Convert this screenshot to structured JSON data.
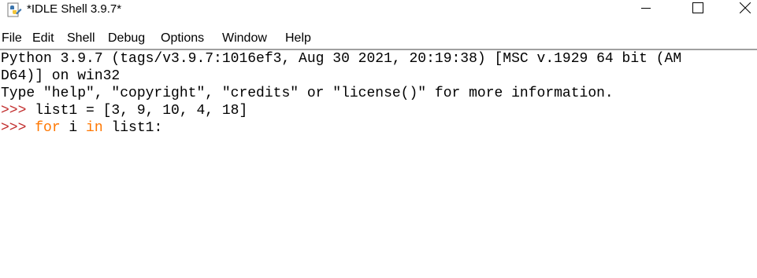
{
  "window": {
    "title": "*IDLE Shell 3.9.7*",
    "icon": "python-idle-icon"
  },
  "controls": {
    "minimize_icon": "minimize-icon",
    "maximize_icon": "maximize-icon",
    "close_icon": "close-icon"
  },
  "menu": {
    "file": "File",
    "edit": "Edit",
    "shell": "Shell",
    "debug": "Debug",
    "options": "Options",
    "window": "Window",
    "help": "Help"
  },
  "shell": {
    "banner_line1": "Python 3.9.7 (tags/v3.9.7:1016ef3, Aug 30 2021, 20:19:38) [MSC v.1929 64 bit (AM",
    "banner_line2": "D64)] on win32",
    "banner_line3": "Type \"help\", \"copyright\", \"credits\" or \"license()\" for more information.",
    "prompt": ">>>",
    "input1": " list1 = [3, 9, 10, 4, 18]",
    "input2_kw1": "for",
    "input2_mid": " i ",
    "input2_kw2": "in",
    "input2_tail": " list1:"
  },
  "colors": {
    "prompt": "#c22e2e",
    "keyword": "#ff7700",
    "text": "#000000",
    "background": "#ffffff"
  }
}
